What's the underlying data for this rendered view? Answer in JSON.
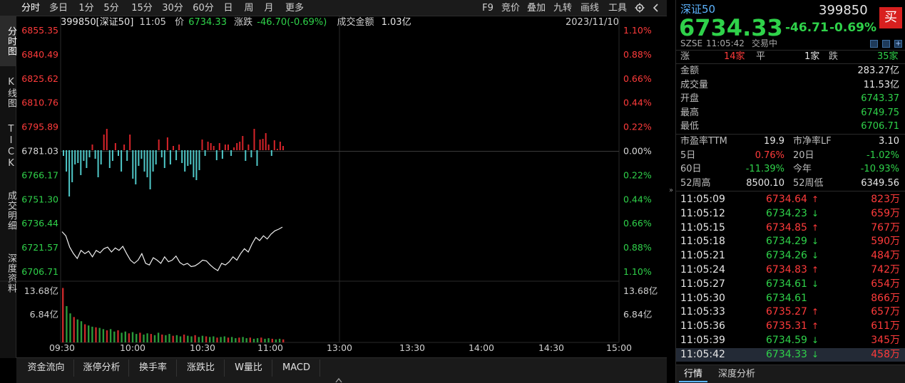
{
  "toolbar": {
    "periods": [
      "分时",
      "多日",
      "1分",
      "5分",
      "15分",
      "30分",
      "60分",
      "日",
      "周",
      "月",
      "更多"
    ],
    "right": [
      "F9",
      "竞价",
      "叠加",
      "九转",
      "画线",
      "工具"
    ],
    "settings_icon": "gear-icon"
  },
  "left_tabs": [
    "分时图",
    "K线图",
    "TICK",
    "成交明细",
    "深度资料"
  ],
  "info_bar": {
    "code_name": "399850[深证50]",
    "time": "11:05",
    "price_label": "价",
    "price": "6734.33",
    "change_label": "涨跌",
    "change": "-46.70(-0.69%)",
    "amount_label": "成交金额",
    "amount": "1.03亿",
    "date": "2023/11/10"
  },
  "chart_data": {
    "type": "line",
    "price_axis": {
      "ticks": [
        "6855.35",
        "6840.49",
        "6825.62",
        "6810.76",
        "6795.89",
        "6781.03",
        "6766.17",
        "6751.30",
        "6736.44",
        "6721.57",
        "6706.71"
      ],
      "pct_ticks": [
        "1.10%",
        "0.88%",
        "0.66%",
        "0.44%",
        "0.22%",
        "0.00%",
        "0.22%",
        "0.44%",
        "0.66%",
        "0.88%",
        "1.10%"
      ],
      "ylim": [
        6706.71,
        6855.35
      ],
      "prev_close": 6781.03
    },
    "volume_axis": {
      "ticks": [
        "13.68亿",
        "6.84亿"
      ]
    },
    "x_ticks": [
      "09:30",
      "10:00",
      "10:30",
      "11:00",
      "13:00",
      "13:30",
      "14:00",
      "14:30",
      "15:00"
    ],
    "price_series": [
      6731.5,
      6729.0,
      6722.0,
      6718.0,
      6715.0,
      6720.0,
      6718.0,
      6719.5,
      6716.0,
      6720.0,
      6718.5,
      6721.0,
      6722.0,
      6719.0,
      6721.5,
      6720.0,
      6722.5,
      6718.0,
      6714.0,
      6712.0,
      6714.0,
      6718.0,
      6712.0,
      6711.0,
      6715.5,
      6714.0,
      6712.0,
      6716.0,
      6713.0,
      6714.0,
      6716.5,
      6712.5,
      6711.0,
      6712.0,
      6710.0,
      6710.5,
      6712.0,
      6714.0,
      6713.5,
      6711.0,
      6709.0,
      6707.5,
      6712.0,
      6711.0,
      6713.0,
      6716.0,
      6714.0,
      6718.0,
      6721.0,
      6719.0,
      6724.0,
      6728.0,
      6726.0,
      6729.0,
      6727.0,
      6730.0,
      6732.0,
      6733.0,
      6734.33
    ],
    "bars": [
      -8,
      -30,
      -65,
      -45,
      -20,
      -18,
      -35,
      -15,
      -25,
      -10,
      8,
      -12,
      -38,
      -20,
      22,
      30,
      -25,
      -15,
      10,
      -8,
      -30,
      8,
      -15,
      22,
      -40,
      -48,
      -22,
      -12,
      -30,
      -38,
      -55,
      -30,
      -20,
      15,
      -10,
      -25,
      18,
      -20,
      6,
      -14,
      8,
      -18,
      -30,
      -22,
      -20,
      -38,
      -42,
      -28,
      15,
      -8,
      12,
      10,
      6,
      -14,
      10,
      -12,
      8,
      8,
      -8,
      4,
      10,
      12,
      20,
      -15,
      8,
      -10,
      30,
      -22,
      15,
      16,
      24,
      8,
      -8,
      14,
      2,
      12,
      6
    ],
    "volumes": [
      90,
      60,
      48,
      42,
      38,
      35,
      30,
      28,
      26,
      25,
      24,
      22,
      20,
      22,
      18,
      20,
      16,
      18,
      15,
      17,
      14,
      16,
      13,
      15,
      14,
      12,
      16,
      13,
      12,
      14,
      11,
      12,
      10,
      13,
      11,
      10,
      12,
      9,
      11,
      10,
      9,
      10,
      8,
      9,
      10,
      8,
      9,
      7,
      8,
      9,
      7,
      8,
      6,
      7,
      8,
      6,
      7,
      6,
      5,
      6,
      5
    ]
  },
  "bottom_tabs": [
    "资金流向",
    "涨停分析",
    "换手率",
    "涨跌比",
    "W量比",
    "MACD"
  ],
  "sidebar": {
    "name": "深证50",
    "code": "399850",
    "buy_label": "买",
    "price": "6734.33",
    "change": "-46.71",
    "change_pct": "-0.69%",
    "exchange": "SZSE",
    "time": "11:05:42",
    "status": "交易中",
    "up_label": "涨",
    "up_count": "14家",
    "flat_label": "平",
    "flat_count": "1家",
    "down_label": "跌",
    "down_count": "35家",
    "stats": [
      {
        "label": "金额",
        "value": "283.27亿",
        "color": "white"
      },
      {
        "label": "成交量",
        "value": "11.53亿",
        "color": "white"
      },
      {
        "label": "开盘",
        "value": "6743.37",
        "color": "green"
      },
      {
        "label": "最高",
        "value": "6749.75",
        "color": "green"
      },
      {
        "label": "最低",
        "value": "6706.71",
        "color": "green"
      }
    ],
    "grid": [
      {
        "l1": "市盈率TTM",
        "v1": "19.9",
        "c1": "white",
        "l2": "市净率LF",
        "v2": "3.10",
        "c2": "white"
      },
      {
        "l1": "5日",
        "v1": "0.76%",
        "c1": "red",
        "l2": "20日",
        "v2": "-1.02%",
        "c2": "green"
      },
      {
        "l1": "60日",
        "v1": "-11.39%",
        "c1": "green",
        "l2": "今年",
        "v2": "-10.93%",
        "c2": "green"
      },
      {
        "l1": "52周高",
        "v1": "8500.10",
        "c1": "white",
        "l2": "52周低",
        "v2": "6349.56",
        "c2": "white"
      }
    ],
    "ticks": [
      {
        "time": "11:05:09",
        "price": "6734.64",
        "dir": "up",
        "vol": "823万"
      },
      {
        "time": "11:05:12",
        "price": "6734.23",
        "dir": "down",
        "vol": "659万"
      },
      {
        "time": "11:05:15",
        "price": "6734.85",
        "dir": "up",
        "vol": "767万"
      },
      {
        "time": "11:05:18",
        "price": "6734.29",
        "dir": "down",
        "vol": "590万"
      },
      {
        "time": "11:05:21",
        "price": "6734.26",
        "dir": "down",
        "vol": "484万"
      },
      {
        "time": "11:05:24",
        "price": "6734.83",
        "dir": "up",
        "vol": "742万"
      },
      {
        "time": "11:05:27",
        "price": "6734.61",
        "dir": "down",
        "vol": "654万"
      },
      {
        "time": "11:05:30",
        "price": "6734.61",
        "dir": "none",
        "vol": "866万"
      },
      {
        "time": "11:05:33",
        "price": "6735.27",
        "dir": "up",
        "vol": "657万"
      },
      {
        "time": "11:05:36",
        "price": "6735.31",
        "dir": "up",
        "vol": "611万"
      },
      {
        "time": "11:05:39",
        "price": "6734.59",
        "dir": "down",
        "vol": "345万"
      },
      {
        "time": "11:05:42",
        "price": "6734.33",
        "dir": "down",
        "vol": "458万"
      }
    ],
    "bottom_tabs": [
      "行情",
      "深度分析"
    ]
  },
  "colors": {
    "up": "#ff3b3b",
    "down": "#2fd24a",
    "bar_down": "#4fc8c8",
    "grid": "#2a2a2a"
  }
}
